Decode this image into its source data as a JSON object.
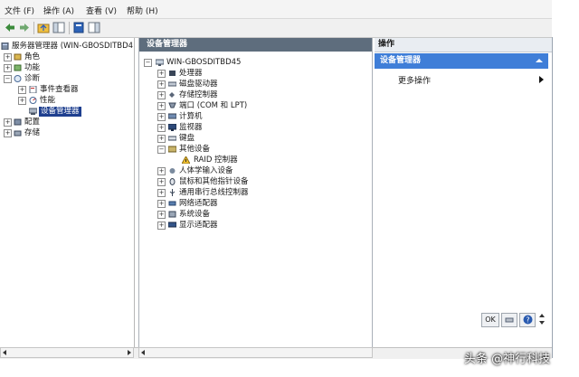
{
  "menubar": {
    "items": [
      "文件 (F)",
      "操作 (A)",
      "查看 (V)",
      "帮助 (H)"
    ]
  },
  "left_tree": {
    "root": "服务器管理器 (WIN-GBOSDITBD4",
    "roles": "角色",
    "features": "功能",
    "diagnostics": "诊断",
    "event_viewer": "事件查看器",
    "reliability": "性能",
    "device_manager": "设备管理器",
    "configuration": "配置",
    "storage": "存储"
  },
  "center": {
    "header": "设备管理器",
    "computer": "WIN-GBOSDITBD45",
    "devices": [
      "处理器",
      "磁盘驱动器",
      "存储控制器",
      "端口 (COM 和 LPT)",
      "计算机",
      "监视器",
      "键盘",
      "其他设备",
      "RAID 控制器",
      "人体学输入设备",
      "鼠标和其他指针设备",
      "通用串行总线控制器",
      "网络适配器",
      "系统设备",
      "显示适配器"
    ]
  },
  "actions": {
    "title": "操作",
    "group": "设备管理器",
    "more": "更多操作"
  },
  "helpbar": {
    "ok_label": "OK"
  },
  "watermark": "头条 @神行科技",
  "colors": {
    "header_bg": "#5e6d7d",
    "action_group_bg": "#3f7ed8",
    "selection_bg": "#1e3f8f"
  }
}
